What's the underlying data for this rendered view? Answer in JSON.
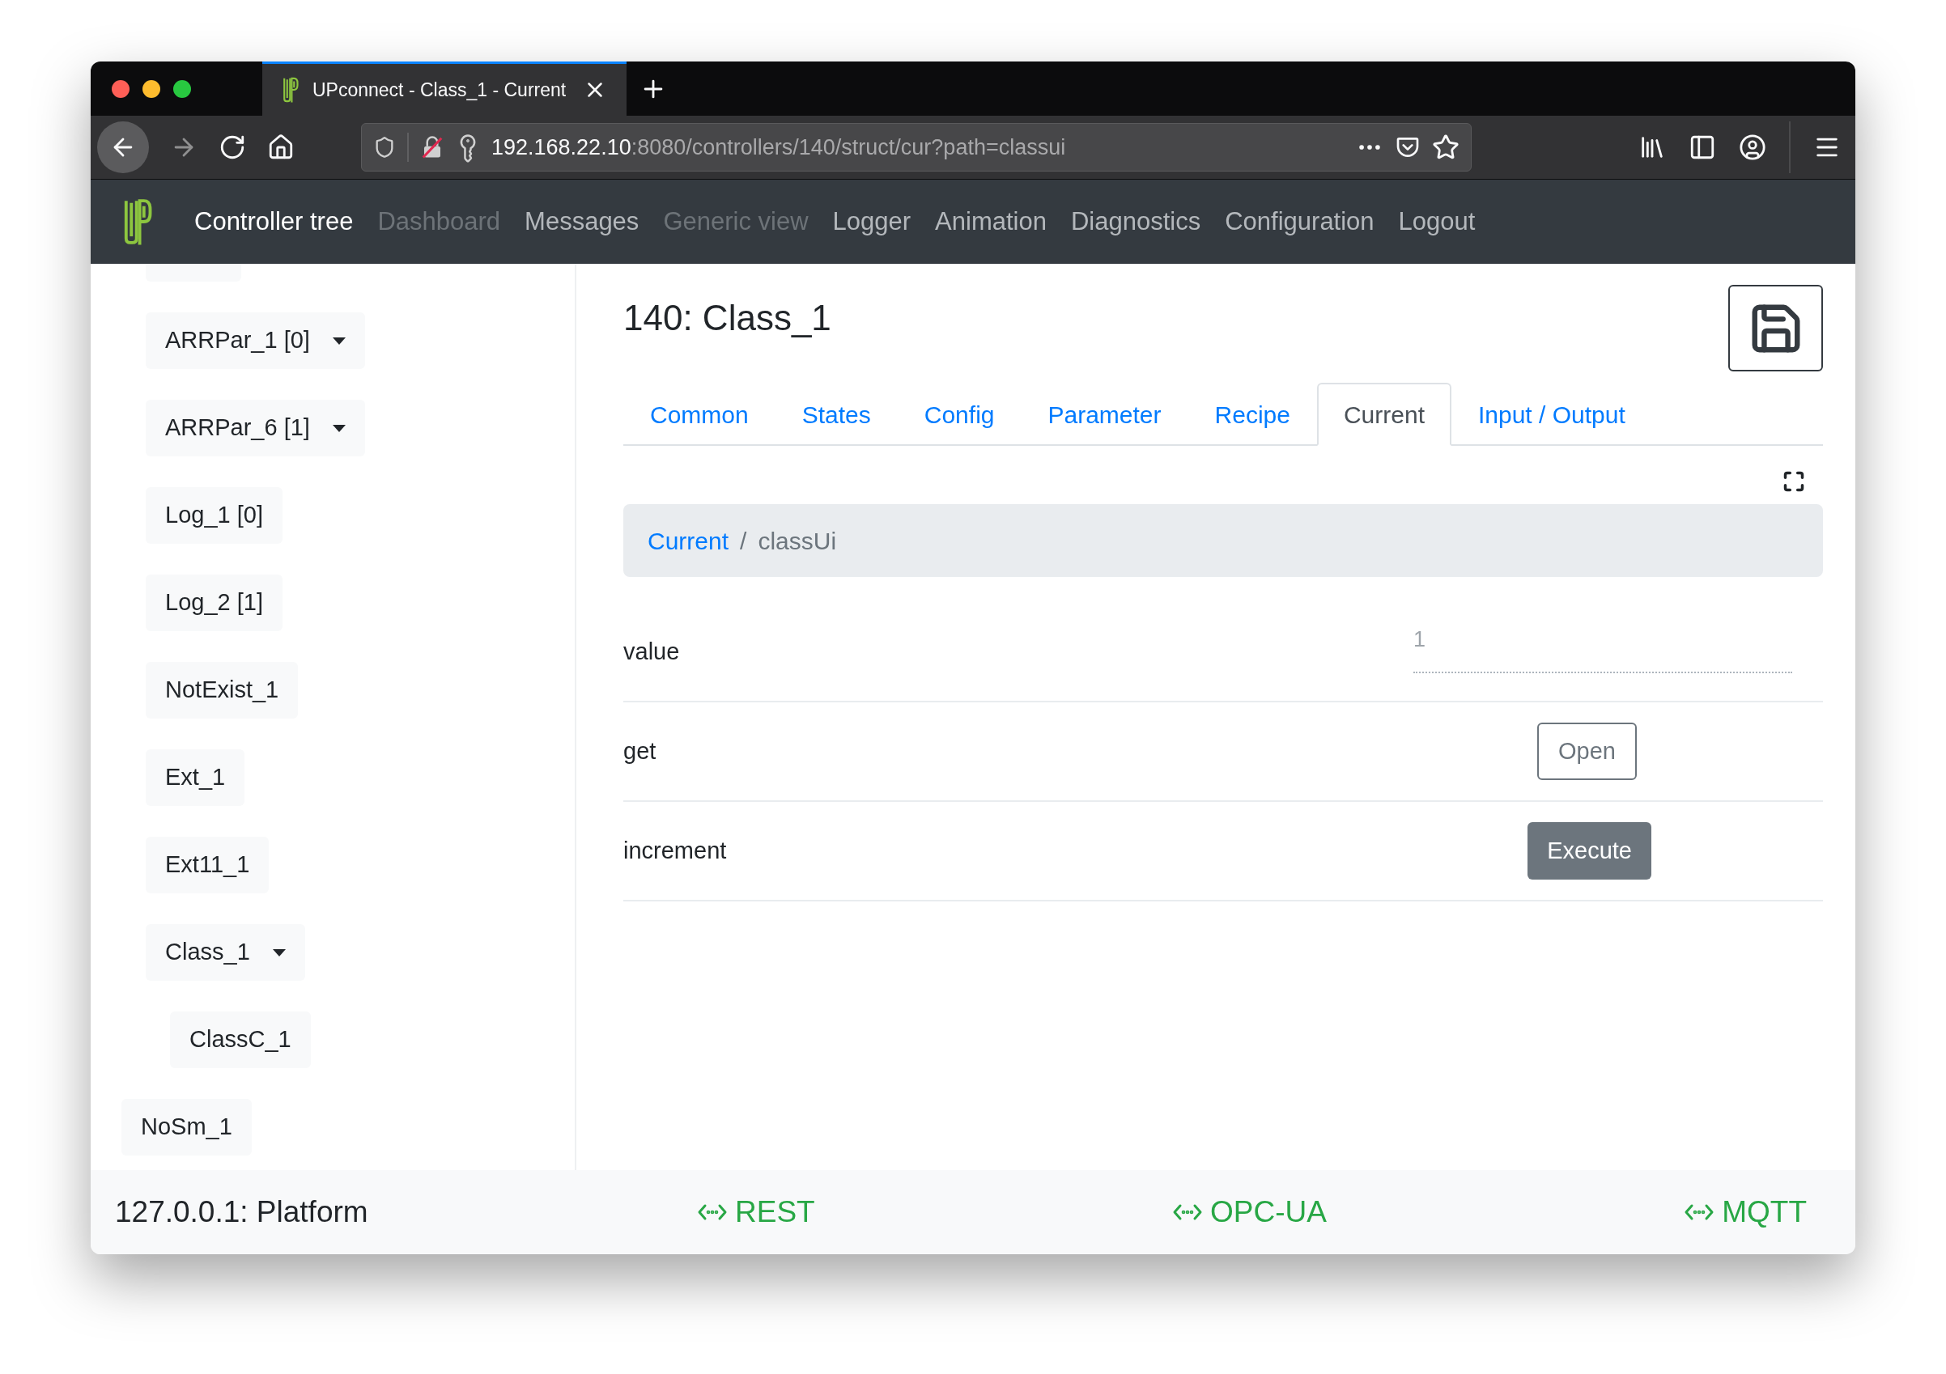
{
  "browser": {
    "tab_title": "UPconnect - Class_1 - Current",
    "url_host": "192.168.22.10",
    "url_rest": ":8080/controllers/140/struct/cur?path=classui"
  },
  "navbar": {
    "items": [
      {
        "label": "Controller tree",
        "active": true,
        "disabled": false
      },
      {
        "label": "Dashboard",
        "active": false,
        "disabled": true
      },
      {
        "label": "Messages",
        "active": false,
        "disabled": false
      },
      {
        "label": "Generic view",
        "active": false,
        "disabled": true
      },
      {
        "label": "Logger",
        "active": false,
        "disabled": false
      },
      {
        "label": "Animation",
        "active": false,
        "disabled": false
      },
      {
        "label": "Diagnostics",
        "active": false,
        "disabled": false
      },
      {
        "label": "Configuration",
        "active": false,
        "disabled": false
      },
      {
        "label": "Logout",
        "active": false,
        "disabled": false
      }
    ]
  },
  "sidebar": {
    "items": [
      {
        "kind": "group",
        "children": [
          {
            "kind": "cut"
          },
          {
            "kind": "item",
            "label": "ARRPar_1 [0]",
            "dropdown": true
          },
          {
            "kind": "item",
            "label": "ARRPar_6 [1]",
            "dropdown": true
          },
          {
            "kind": "item",
            "label": "Log_1 [0]",
            "dropdown": false
          },
          {
            "kind": "item",
            "label": "Log_2 [1]",
            "dropdown": false
          },
          {
            "kind": "item",
            "label": "NotExist_1",
            "dropdown": false
          },
          {
            "kind": "item",
            "label": "Ext_1",
            "dropdown": false
          },
          {
            "kind": "item",
            "label": "Ext11_1",
            "dropdown": false
          },
          {
            "kind": "item",
            "label": "Class_1",
            "dropdown": true,
            "children": [
              {
                "kind": "item",
                "label": "ClassC_1",
                "dropdown": false
              }
            ]
          }
        ]
      },
      {
        "kind": "item",
        "label": "NoSm_1",
        "dropdown": false
      }
    ]
  },
  "main": {
    "title": "140: Class_1",
    "tabs": [
      {
        "label": "Common",
        "selected": false
      },
      {
        "label": "States",
        "selected": false
      },
      {
        "label": "Config",
        "selected": false
      },
      {
        "label": "Parameter",
        "selected": false
      },
      {
        "label": "Recipe",
        "selected": false
      },
      {
        "label": "Current",
        "selected": true
      },
      {
        "label": "Input / Output",
        "selected": false
      }
    ],
    "breadcrumb_separator": "/",
    "breadcrumb": [
      {
        "label": "Current",
        "link": true
      },
      {
        "label": "classUi",
        "link": false
      }
    ],
    "rows": [
      {
        "label": "value",
        "kind": "field",
        "value": "1"
      },
      {
        "label": "get",
        "kind": "outline-button",
        "button": "Open"
      },
      {
        "label": "increment",
        "kind": "solid-button",
        "button": "Execute"
      }
    ]
  },
  "footer": {
    "platform": "127.0.0.1: Platform",
    "links": [
      "REST",
      "OPC-UA",
      "MQTT"
    ]
  }
}
